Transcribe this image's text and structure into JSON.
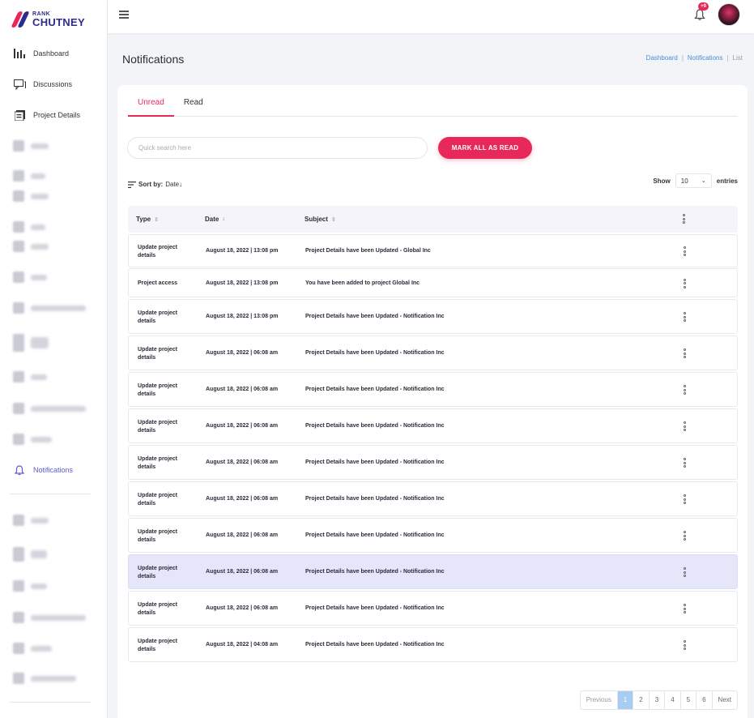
{
  "brand": {
    "small": "RANK",
    "big": "CHUTNEY"
  },
  "sidebar": {
    "items": [
      {
        "label": "Dashboard",
        "icon": "bar-chart-icon"
      },
      {
        "label": "Discussions",
        "icon": "chat-icon"
      },
      {
        "label": "Project Details",
        "icon": "document-icon"
      },
      {
        "label": "Notifications",
        "icon": "bell-icon"
      }
    ]
  },
  "topbar": {
    "notification_count": "+9"
  },
  "page": {
    "title": "Notifications"
  },
  "breadcrumb": {
    "item1": "Dashboard",
    "item2": "Notifications",
    "current": "List",
    "sep": "|"
  },
  "tabs": {
    "unread": "Unread",
    "read": "Read"
  },
  "search": {
    "placeholder": "Quick search here"
  },
  "actions": {
    "mark_all": "MARK ALL AS READ"
  },
  "sort": {
    "label": "Sort by:",
    "value": "Date↓"
  },
  "show": {
    "label": "Show",
    "value": "10",
    "suffix": "entries"
  },
  "table": {
    "headers": {
      "type": "Type",
      "date": "Date",
      "subject": "Subject"
    },
    "rows": [
      {
        "type": "Update project details",
        "date": "August 18, 2022 | 13:08 pm",
        "subject": "Project Details have been Updated - Global Inc"
      },
      {
        "type": "Project access",
        "date": "August 18, 2022 | 13:08 pm",
        "subject": "You have been added to project Global Inc"
      },
      {
        "type": "Update project details",
        "date": "August 18, 2022 | 13:08 pm",
        "subject": "Project Details have been Updated - Notification Inc"
      },
      {
        "type": "Update project details",
        "date": "August 18, 2022 | 06:08 am",
        "subject": "Project Details have been Updated - Notification Inc"
      },
      {
        "type": "Update project details",
        "date": "August 18, 2022 | 06:08 am",
        "subject": "Project Details have been Updated - Notification Inc"
      },
      {
        "type": "Update project details",
        "date": "August 18, 2022 | 06:08 am",
        "subject": "Project Details have been Updated - Notification Inc"
      },
      {
        "type": "Update project details",
        "date": "August 18, 2022 | 06:08 am",
        "subject": "Project Details have been Updated - Notification Inc"
      },
      {
        "type": "Update project details",
        "date": "August 18, 2022 | 06:08 am",
        "subject": "Project Details have been Updated - Notification Inc"
      },
      {
        "type": "Update project details",
        "date": "August 18, 2022 | 06:08 am",
        "subject": "Project Details have been Updated - Notification Inc"
      },
      {
        "type": "Update project details",
        "date": "August 18, 2022 | 06:08 am",
        "subject": "Project Details have been Updated - Notification Inc"
      },
      {
        "type": "Update project details",
        "date": "August 18, 2022 | 06:08 am",
        "subject": "Project Details have been Updated - Notification Inc"
      },
      {
        "type": "Update project details",
        "date": "August 18, 2022 | 04:08 am",
        "subject": "Project Details have been Updated - Notification Inc"
      }
    ],
    "highlighted_row": 9
  },
  "pagination": {
    "previous": "Previous",
    "pages": [
      "1",
      "2",
      "3",
      "4",
      "5",
      "6"
    ],
    "next": "Next",
    "current": "1"
  },
  "colors": {
    "accent": "#e8285b",
    "brand": "#2c2b8f",
    "link": "#4a8bd6",
    "active_nav": "#5b5bd6"
  }
}
